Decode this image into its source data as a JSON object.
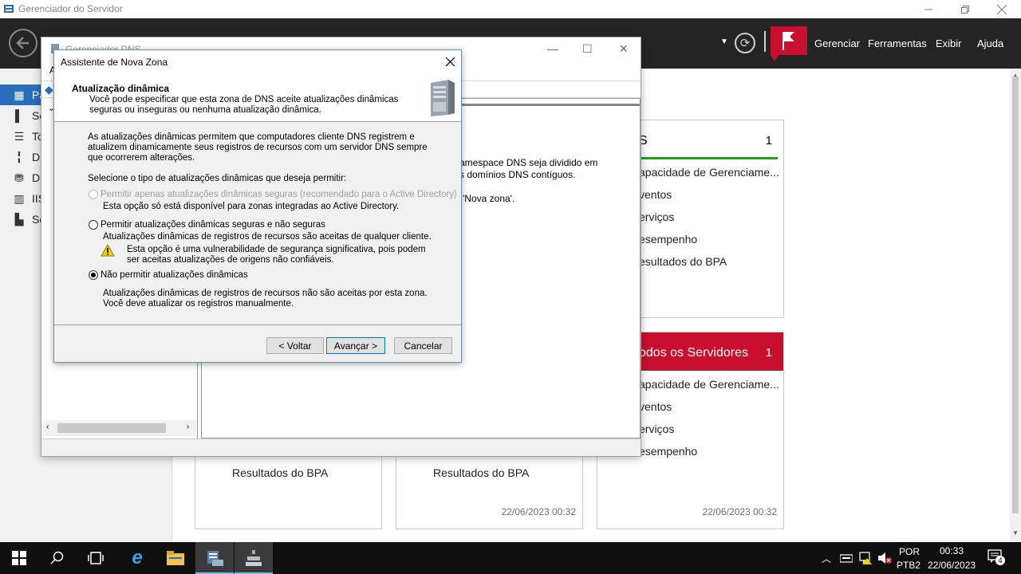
{
  "server_manager": {
    "title": "Gerenciador do Servidor",
    "menu": [
      "Gerenciar",
      "Ferramentas",
      "Exibir",
      "Ajuda"
    ],
    "sidebar": [
      {
        "label": "Pa",
        "icon": "dashboard-icon"
      },
      {
        "label": "Se",
        "icon": "server-icon"
      },
      {
        "label": "To",
        "icon": "all-servers-icon"
      },
      {
        "label": "DI",
        "icon": "dhcp-icon"
      },
      {
        "label": "DI",
        "icon": "dns-icon"
      },
      {
        "label": "IIS",
        "icon": "iis-icon"
      },
      {
        "label": "Se",
        "icon": "file-services-icon"
      }
    ],
    "tiles": [
      {
        "name": "S",
        "count": "1",
        "rows": [
          "apacidade de Gerenciame...",
          "ventos",
          "erviços",
          "esempenho",
          "esultados do BPA"
        ]
      },
      {
        "name": "odos os Servidores",
        "count": "1",
        "rows": [
          "apacidade de Gerenciame...",
          "ventos",
          "erviços",
          "esempenho"
        ]
      }
    ],
    "bottom_tiles": [
      {
        "label": "Resultados do BPA",
        "timestamp": ""
      },
      {
        "label": "Resultados do BPA",
        "timestamp": "22/06/2023 00:32"
      },
      {
        "label": "Resultados do BPA",
        "timestamp": "22/06/2023 00:32"
      }
    ]
  },
  "dns_manager": {
    "title": "Gerenciador DNS",
    "menu_first": "A",
    "right_text_1": "amespace DNS seja dividido em",
    "right_text_2": "s domínios DNS contíguos.",
    "right_text_3": "'Nova zona'."
  },
  "wizard": {
    "title": "Assistente de Nova Zona",
    "header_title": "Atualização dinâmica",
    "header_sub": "Você pode especificar que esta zona de DNS aceite atualizações dinâmicas seguras ou inseguras ou nenhuma atualização dinâmica.",
    "intro": "As atualizações dinâmicas permitem que computadores cliente DNS registrem e atualizem dinamicamente seus registros de recursos com um servidor DNS sempre que ocorrerem alterações.",
    "select_prompt": "Selecione o tipo de atualizações dinâmicas que deseja permitir:",
    "options": [
      {
        "label": "Permitir apenas atualizações dinâmicas seguras (recomendado para o Active Directory)",
        "desc": "Esta opção só está disponível para zonas integradas ao Active Directory.",
        "checked": false,
        "disabled": true
      },
      {
        "label": "Permitir atualizações dinâmicas seguras e não seguras",
        "desc": "Atualizações dinâmicas de registros de recursos são aceitas de qualquer cliente.",
        "warning": "Esta opção é uma vulnerabilidade de segurança significativa, pois podem ser aceitas atualizações de origens não confiáveis.",
        "checked": false,
        "disabled": false
      },
      {
        "label": "Não permitir atualizações dinâmicas",
        "desc": "Atualizações dinâmicas de registros de recursos não são aceitas por esta zona. Você deve atualizar os registros manualmente.",
        "checked": true,
        "disabled": false
      }
    ],
    "buttons": {
      "back": "< Voltar",
      "next": "Avançar >",
      "cancel": "Cancelar"
    }
  },
  "taskbar": {
    "lang_top": "POR",
    "lang_bottom": "PTB2",
    "time": "00:33",
    "date": "22/06/2023",
    "notifications": "4"
  },
  "colors": {
    "accent_red": "#c8102e",
    "accent_green": "#1ea01e",
    "header_dark": "#252526",
    "selection_blue": "#2a6ebb"
  }
}
